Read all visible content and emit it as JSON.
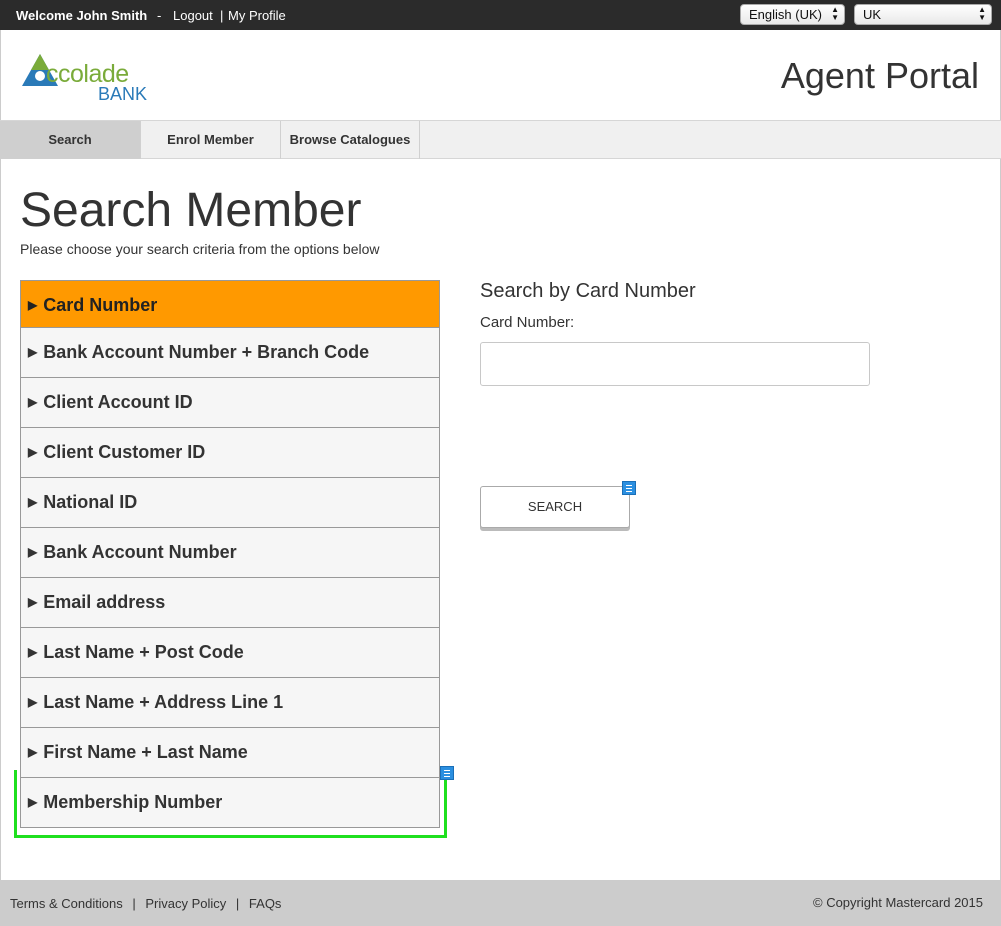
{
  "topbar": {
    "welcome": "Welcome John Smith",
    "dash": "-",
    "logout": "Logout",
    "separator": "|",
    "my_profile": "My Profile",
    "language": "English (UK)",
    "country": "UK"
  },
  "header": {
    "logo_text": "ccolade",
    "logo_bank": "BANK",
    "portal_title": "Agent Portal"
  },
  "nav": {
    "tabs": [
      {
        "label": "Search",
        "active": true
      },
      {
        "label": "Enrol Member",
        "active": false
      },
      {
        "label": "Browse Catalogues",
        "active": false
      }
    ]
  },
  "main": {
    "title": "Search Member",
    "subtitle": "Please choose your search criteria from the options below",
    "criteria": [
      {
        "label": "Card Number",
        "active": true
      },
      {
        "label": "Bank Account Number + Branch Code"
      },
      {
        "label": "Client Account ID"
      },
      {
        "label": "Client Customer ID"
      },
      {
        "label": "National ID"
      },
      {
        "label": "Bank Account Number"
      },
      {
        "label": "Email address"
      },
      {
        "label": "Last Name + Post Code"
      },
      {
        "label": "Last Name + Address Line 1"
      },
      {
        "label": "First Name + Last Name"
      },
      {
        "label": "Membership Number"
      }
    ],
    "search_panel": {
      "title": "Search by Card Number",
      "field_label": "Card Number:",
      "field_value": "",
      "button_label": "SEARCH"
    }
  },
  "footer": {
    "terms": "Terms & Conditions",
    "privacy": "Privacy Policy",
    "faqs": "FAQs",
    "link_separator": "|",
    "copyright": "© Copyright Mastercard 2015"
  },
  "colors": {
    "active_criterion": "#ff9900",
    "topbar": "#2b2b2b",
    "highlight_outline": "#1fe01f",
    "note_icon": "#2b8fe0"
  },
  "icons": {
    "criterion_marker": "▶",
    "select_arrows": "▲▼"
  }
}
